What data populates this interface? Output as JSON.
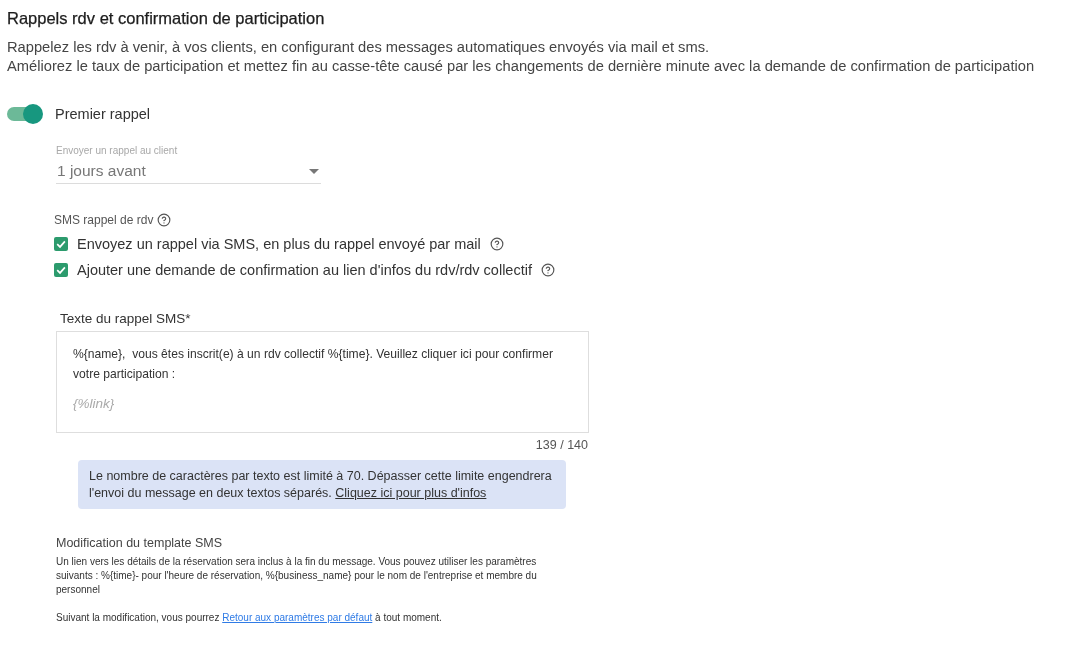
{
  "section": {
    "title": "Rappels rdv et confirmation de participation",
    "description": [
      "Rappelez les rdv à venir, à vos clients, en configurant des messages automatiques envoyés via mail et sms.",
      "Améliorez le taux de participation et mettez fin au casse-tête causé par les changements de dernière minute avec la demande de confirmation de participation"
    ]
  },
  "reminder": {
    "label": "Premier rappel",
    "on": true
  },
  "send_select": {
    "label": "Envoyer un rappel au client",
    "value": "1 jours avant"
  },
  "sms": {
    "heading": "SMS rappel de rdv",
    "options": [
      {
        "label": "Envoyez un rappel via SMS, en plus du rappel envoyé par mail",
        "checked": true
      },
      {
        "label": "Ajouter une demande de confirmation au lien d'infos du rdv/rdv collectif",
        "checked": true
      }
    ]
  },
  "sms_text": {
    "label": "Texte du rappel SMS*",
    "value": "%{name},  vous êtes inscrit(e) à un rdv collectif %{time}. Veuillez cliquer ici pour confirmer votre participation :",
    "link_token": "{%link}",
    "counter": "139 / 140"
  },
  "info": {
    "text": "Le nombre de caractères par texto est limité à 70. Dépasser cette limite engendrera l'envoi du message en deux textos séparés.",
    "link": "Cliquez ici pour plus d'infos"
  },
  "template": {
    "heading": "Modification du template SMS",
    "paragraph": "Un lien vers les détails de la réservation sera inclus à la fin du message. Vous pouvez utiliser les paramètres suivants : %{time}- pour l'heure de réservation, %{business_name} pour le nom de l'entreprise et membre du personnel",
    "note_before": "Suivant la modification, vous pourrez",
    "note_link": "Retour aux paramètres par défaut",
    "note_after": "à tout moment."
  }
}
